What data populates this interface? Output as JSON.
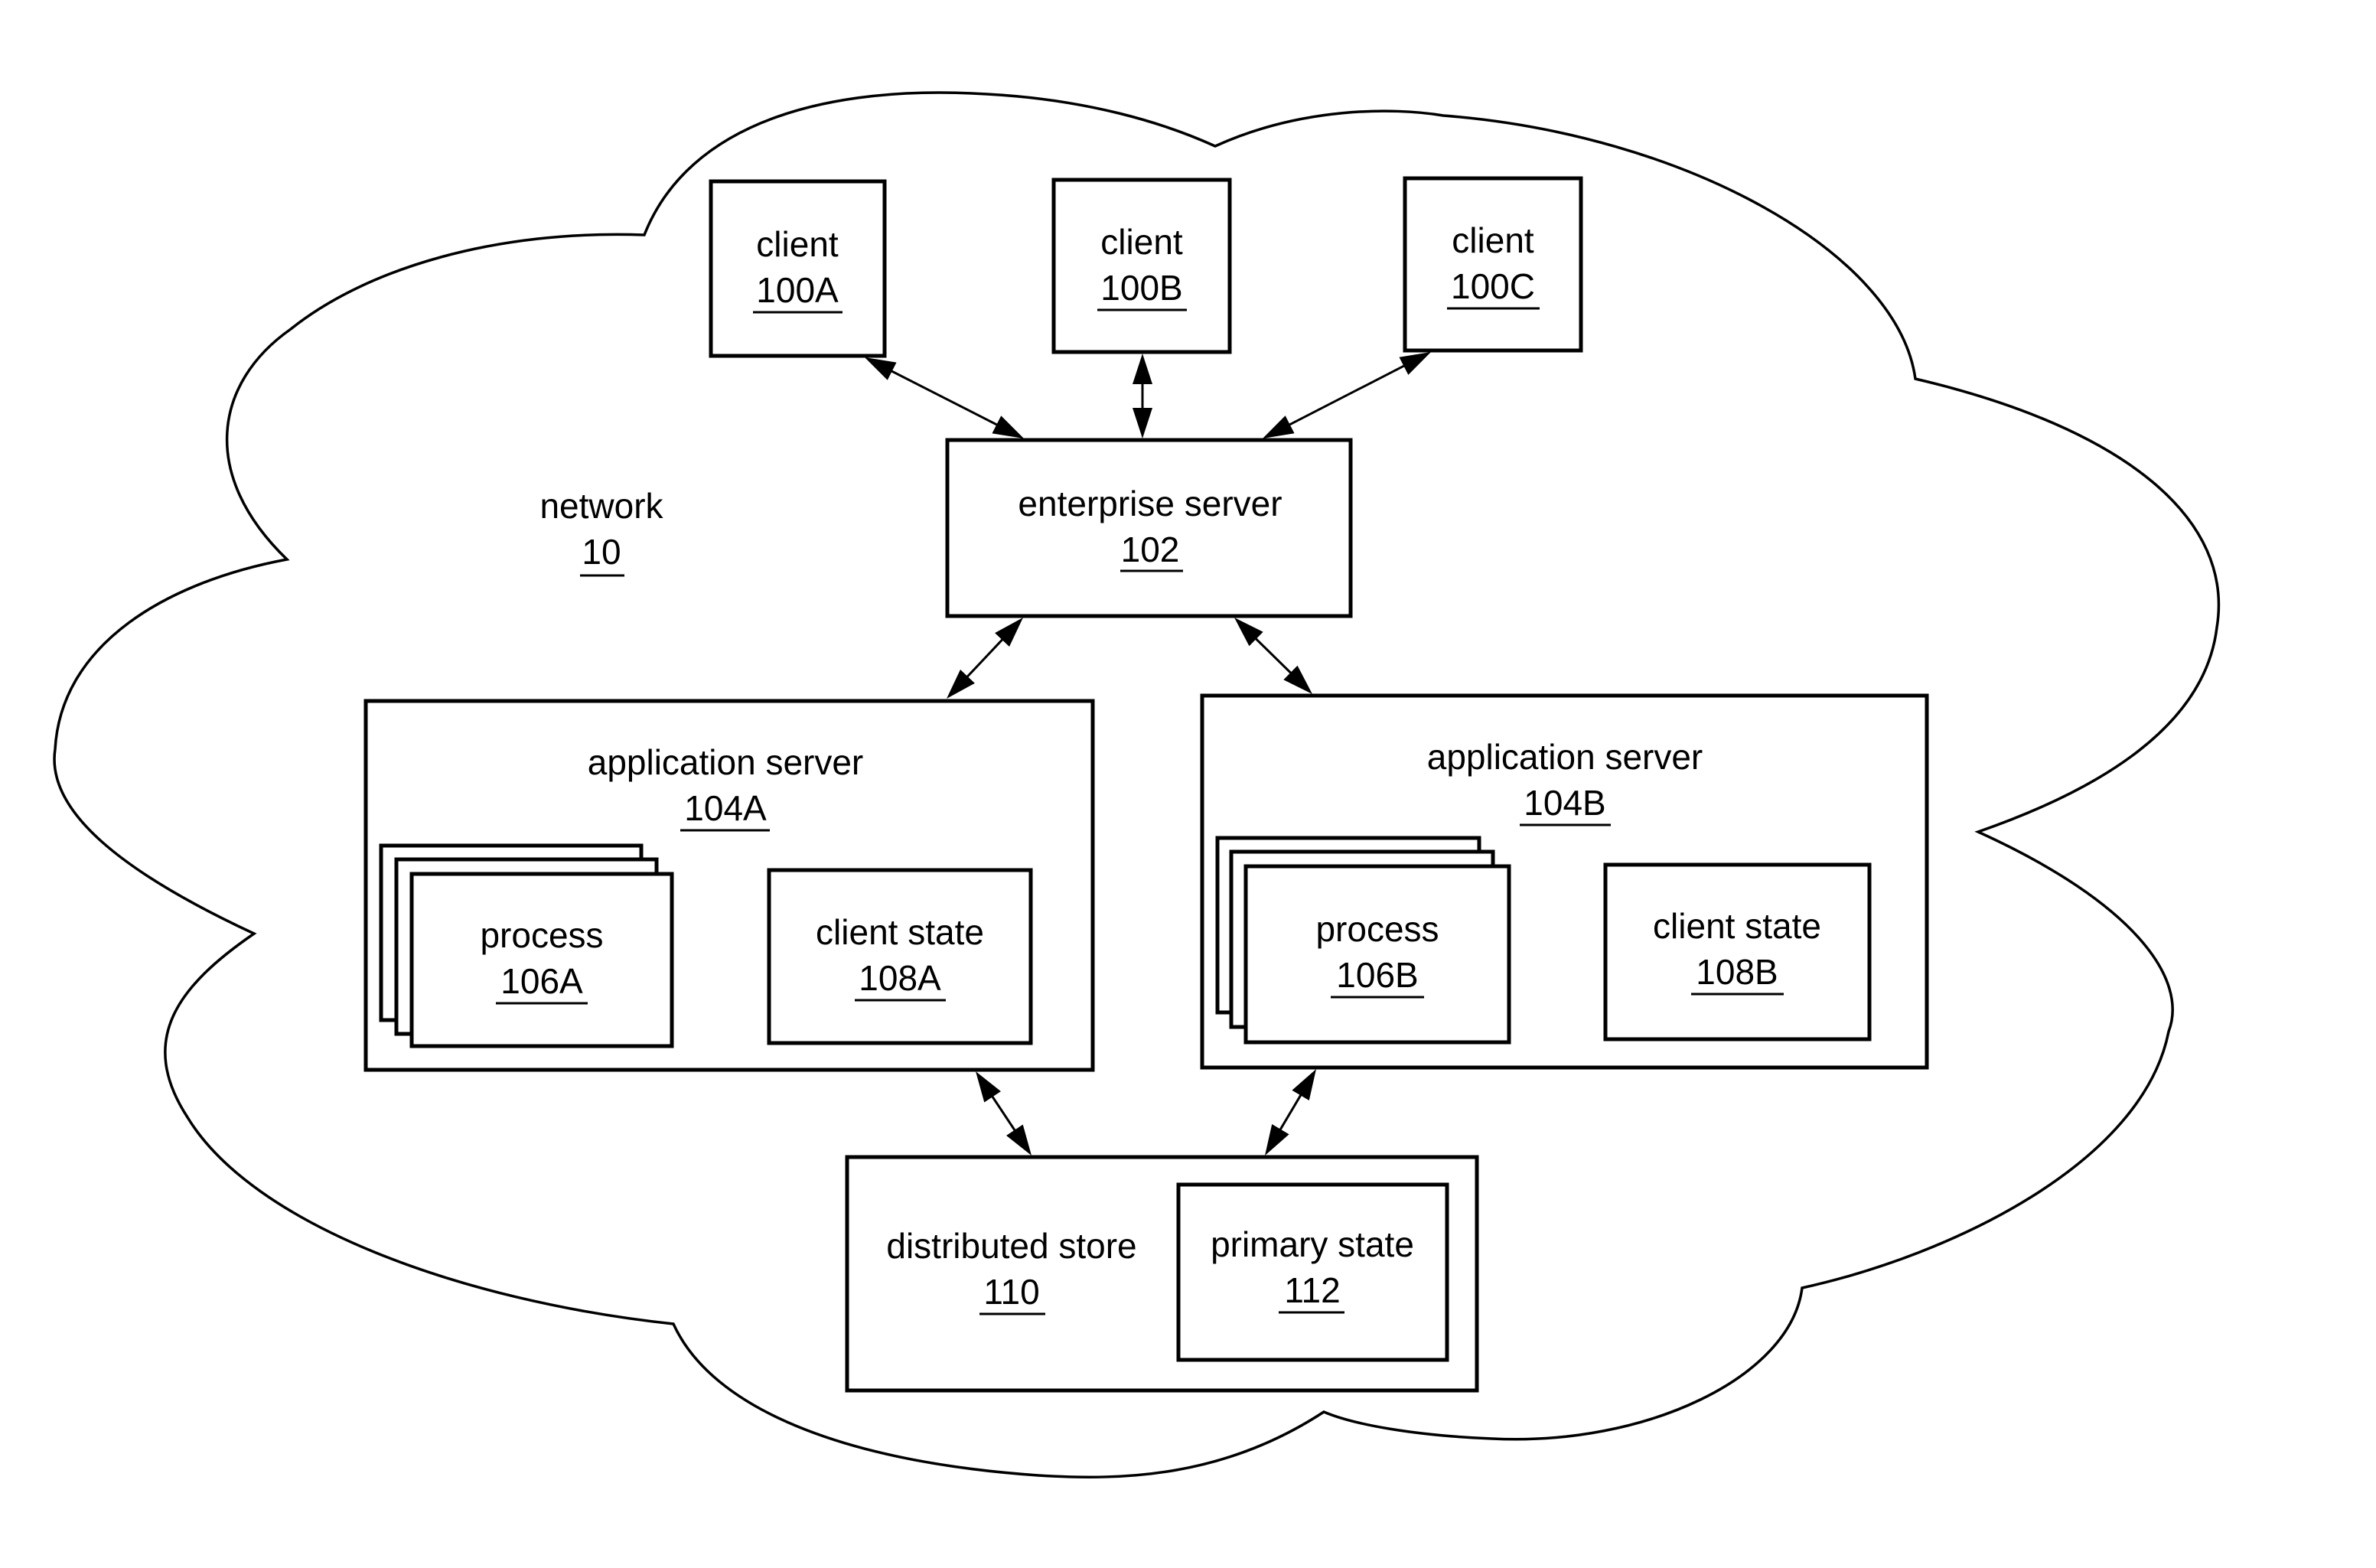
{
  "network": {
    "name": "network",
    "ref": "10"
  },
  "nodes": {
    "client_a": {
      "name": "client",
      "ref": "100A"
    },
    "client_b": {
      "name": "client",
      "ref": "100B"
    },
    "client_c": {
      "name": "client",
      "ref": "100C"
    },
    "enterprise_server": {
      "name": "enterprise server",
      "ref": "102"
    },
    "app_server_a": {
      "name": "application server",
      "ref": "104A"
    },
    "app_server_b": {
      "name": "application server",
      "ref": "104B"
    },
    "process_a": {
      "name": "process",
      "ref": "106A"
    },
    "process_b": {
      "name": "process",
      "ref": "106B"
    },
    "client_state_a": {
      "name": "client state",
      "ref": "108A"
    },
    "client_state_b": {
      "name": "client state",
      "ref": "108B"
    },
    "distributed_store": {
      "name": "distributed store",
      "ref": "110"
    },
    "primary_state": {
      "name": "primary state",
      "ref": "112"
    }
  },
  "connections": [
    {
      "from": "client 100A",
      "to": "enterprise server 102",
      "direction": "bidirectional"
    },
    {
      "from": "client 100B",
      "to": "enterprise server 102",
      "direction": "bidirectional"
    },
    {
      "from": "client 100C",
      "to": "enterprise server 102",
      "direction": "bidirectional"
    },
    {
      "from": "enterprise server 102",
      "to": "application server 104A",
      "direction": "bidirectional"
    },
    {
      "from": "enterprise server 102",
      "to": "application server 104B",
      "direction": "bidirectional"
    },
    {
      "from": "application server 104A",
      "to": "distributed store 110",
      "direction": "bidirectional"
    },
    {
      "from": "application server 104B",
      "to": "distributed store 110",
      "direction": "bidirectional"
    }
  ]
}
